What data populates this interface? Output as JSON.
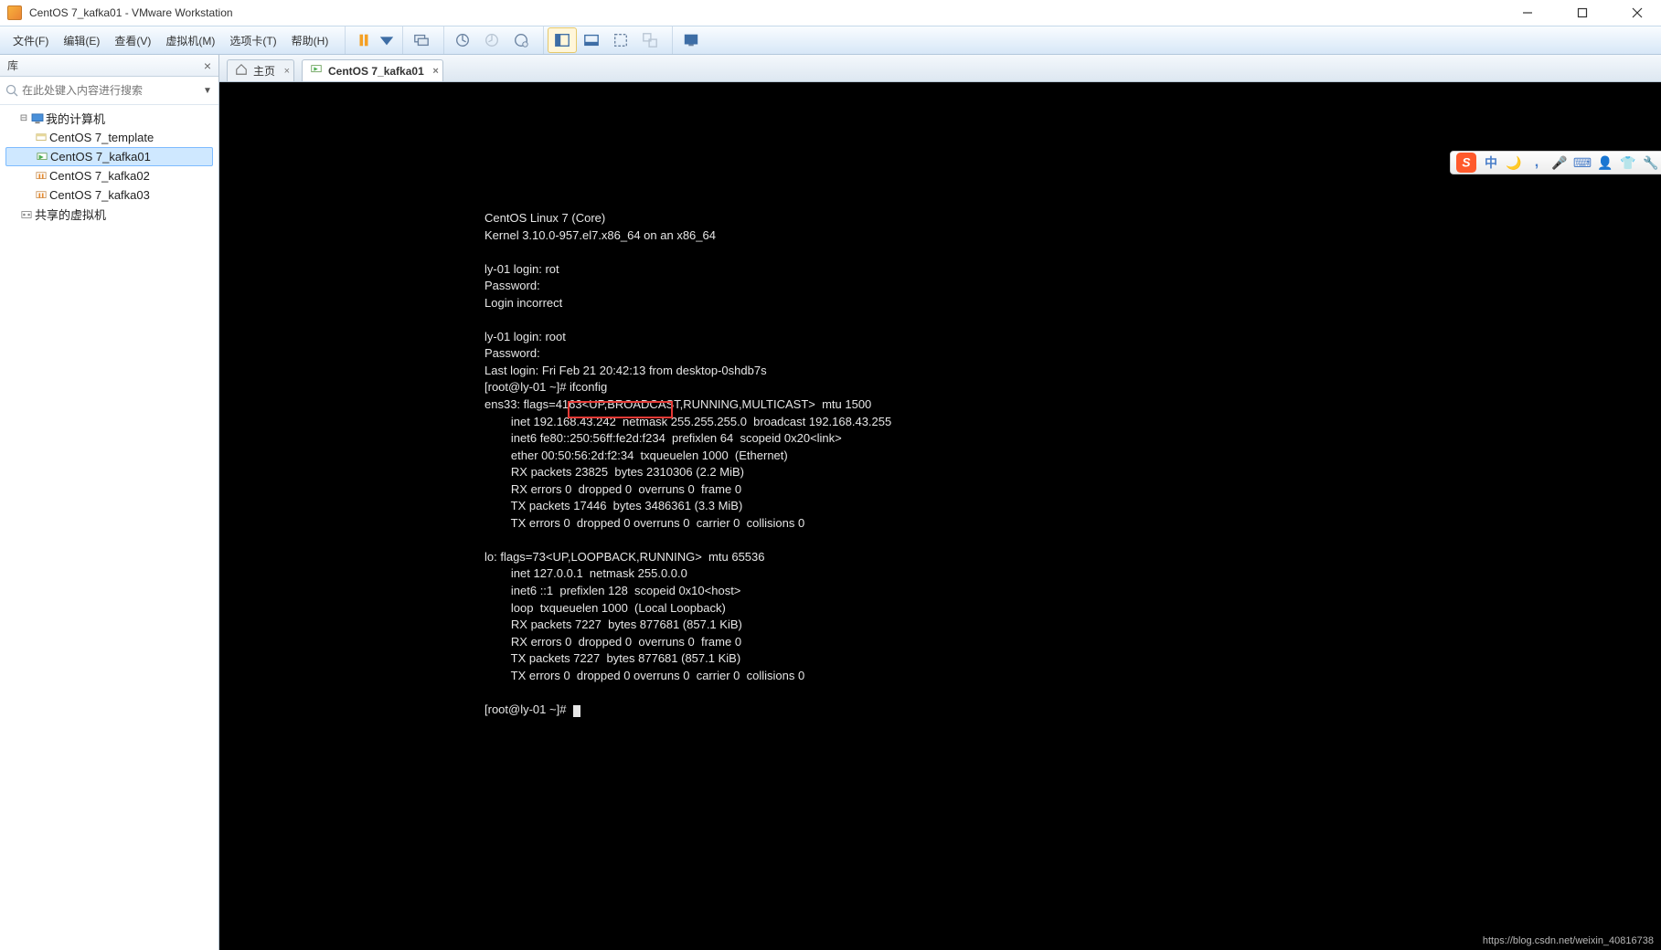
{
  "window": {
    "title": "CentOS 7_kafka01 - VMware Workstation"
  },
  "menubar": {
    "file": "文件(F)",
    "edit": "编辑(E)",
    "view": "查看(V)",
    "vm": "虚拟机(M)",
    "tabs": "选项卡(T)",
    "help": "帮助(H)"
  },
  "sidebar": {
    "title": "库",
    "search_placeholder": "在此处键入内容进行搜索",
    "root": "我的计算机",
    "vms": [
      "CentOS 7_template",
      "CentOS 7_kafka01",
      "CentOS 7_kafka02",
      "CentOS 7_kafka03"
    ],
    "shared": "共享的虚拟机"
  },
  "tabs": {
    "home": "主页",
    "vm": "CentOS 7_kafka01"
  },
  "console": {
    "lines": [
      "CentOS Linux 7 (Core)",
      "Kernel 3.10.0-957.el7.x86_64 on an x86_64",
      "",
      "ly-01 login: rot",
      "Password:",
      "Login incorrect",
      "",
      "ly-01 login: root",
      "Password:",
      "Last login: Fri Feb 21 20:42:13 from desktop-0shdb7s",
      "[root@ly-01 ~]# ifconfig",
      "ens33: flags=4163<UP,BROADCAST,RUNNING,MULTICAST>  mtu 1500",
      "        inet 192.168.43.242  netmask 255.255.255.0  broadcast 192.168.43.255",
      "        inet6 fe80::250:56ff:fe2d:f234  prefixlen 64  scopeid 0x20<link>",
      "        ether 00:50:56:2d:f2:34  txqueuelen 1000  (Ethernet)",
      "        RX packets 23825  bytes 2310306 (2.2 MiB)",
      "        RX errors 0  dropped 0  overruns 0  frame 0",
      "        TX packets 17446  bytes 3486361 (3.3 MiB)",
      "        TX errors 0  dropped 0 overruns 0  carrier 0  collisions 0",
      "",
      "lo: flags=73<UP,LOOPBACK,RUNNING>  mtu 65536",
      "        inet 127.0.0.1  netmask 255.0.0.0",
      "        inet6 ::1  prefixlen 128  scopeid 0x10<host>",
      "        loop  txqueuelen 1000  (Local Loopback)",
      "        RX packets 7227  bytes 877681 (857.1 KiB)",
      "        RX errors 0  dropped 0  overruns 0  frame 0",
      "        TX packets 7227  bytes 877681 (857.1 KiB)",
      "        TX errors 0  dropped 0 overruns 0  carrier 0  collisions 0",
      "",
      "[root@ly-01 ~]# "
    ],
    "highlighted_ip": "192.168.43.242"
  },
  "ime": {
    "lang": "中"
  },
  "watermark": "https://blog.csdn.net/weixin_40816738"
}
